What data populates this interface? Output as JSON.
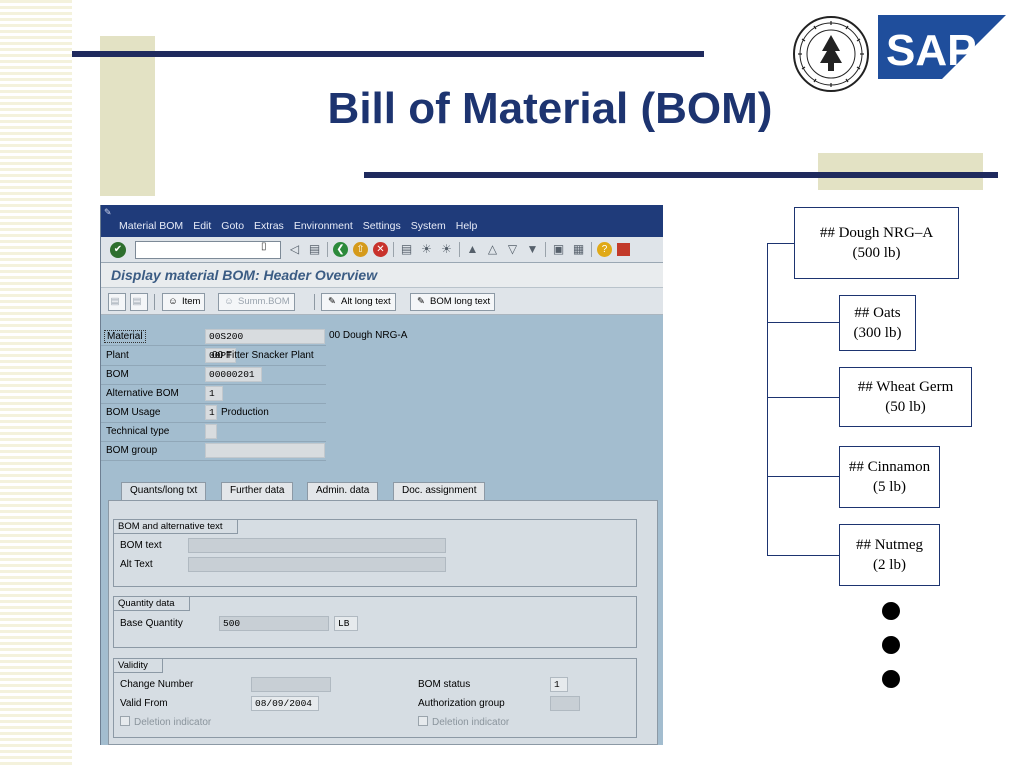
{
  "slide": {
    "title": "Bill of Material (BOM)"
  },
  "colors": {
    "title": "#1d3470",
    "sap_blue": "#1f3b7a",
    "sap_bg": "#a3bdcf",
    "deco": "#e3e2c4"
  },
  "logos": {
    "seal_icon": "university-seal-icon",
    "sap_icon": "sap-logo",
    "sap_text": "SAP"
  },
  "sap_window": {
    "menu": [
      "Material BOM",
      "Edit",
      "Goto",
      "Extras",
      "Environment",
      "Settings",
      "System",
      "Help"
    ],
    "screen_title": "Display material BOM: Header Overview",
    "app_toolbar": {
      "item": "Item",
      "summ_bom": "Summ.BOM",
      "alt_long_text": "Alt long text",
      "bom_long_text": "BOM long text"
    },
    "header_fields": {
      "material_label": "Material",
      "material_value": "00S200",
      "material_desc": "00 Dough NRG-A",
      "plant_label": "Plant",
      "plant_value": "00PT",
      "plant_desc": "00 Fitter Snacker Plant",
      "bom_label": "BOM",
      "bom_value": "00000201",
      "alt_bom_label": "Alternative BOM",
      "alt_bom_value": "1",
      "usage_label": "BOM Usage",
      "usage_value": "1",
      "usage_desc": "Production",
      "tech_type_label": "Technical type",
      "tech_type_value": "",
      "bom_group_label": "BOM group",
      "bom_group_value": ""
    },
    "tabs": [
      "Quants/long txt",
      "Further data",
      "Admin. data",
      "Doc. assignment"
    ],
    "groups": {
      "bom_text": {
        "title": "BOM and alternative text",
        "bom_text_label": "BOM text",
        "bom_text_value": "",
        "alt_text_label": "Alt Text",
        "alt_text_value": ""
      },
      "quantity": {
        "title": "Quantity data",
        "base_qty_label": "Base Quantity",
        "base_qty_value": "500",
        "unit": "LB"
      },
      "validity": {
        "title": "Validity",
        "change_number_label": "Change Number",
        "change_number_value": "",
        "valid_from_label": "Valid From",
        "valid_from_value": "08/09/2004",
        "deletion_label": "Deletion indicator",
        "bom_status_label": "BOM status",
        "bom_status_value": "1",
        "auth_group_label": "Authorization group",
        "auth_group_value": "",
        "deletion_label_2": "Deletion indicator"
      }
    }
  },
  "bom_tree": {
    "parent": "## Dough NRG–A\n(500 lb)",
    "children": [
      "## Oats\n(300 lb)",
      "## Wheat Germ\n(50 lb)",
      "## Cinnamon\n(5 lb)",
      "## Nutmeg\n(2 lb)"
    ]
  }
}
